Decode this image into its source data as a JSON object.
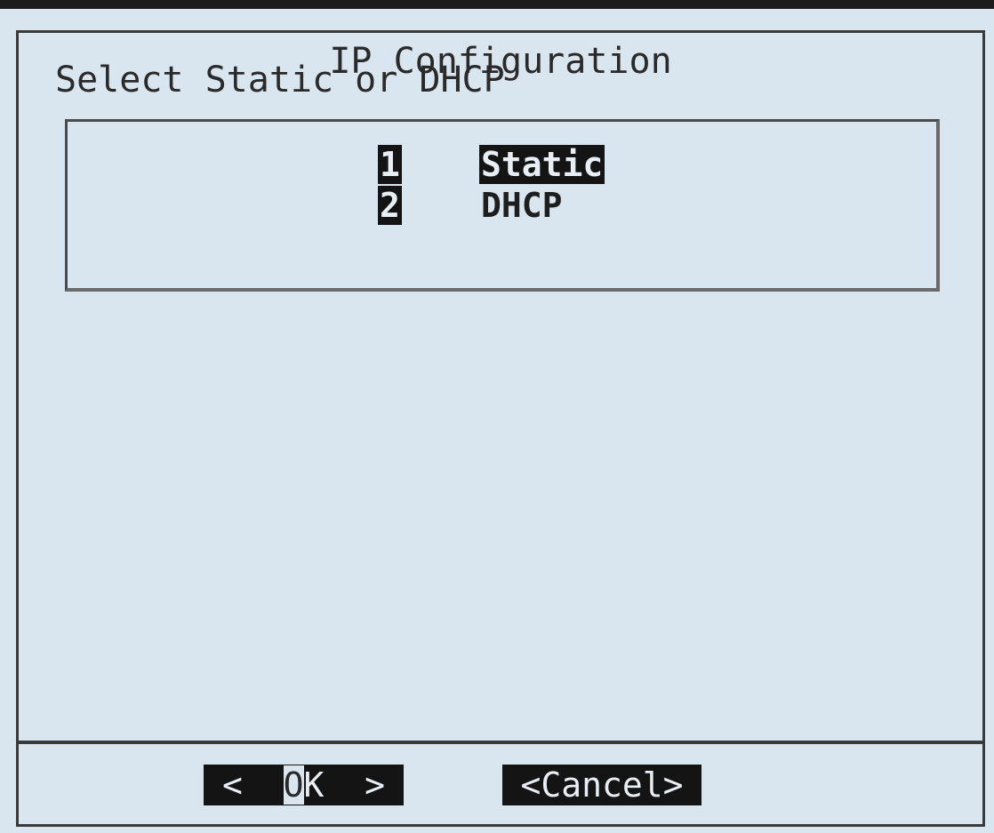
{
  "dialog": {
    "title": "IP Configuration",
    "prompt": "Select Static or DHCP"
  },
  "menu": {
    "items": [
      {
        "tag": "1",
        "label": "Static",
        "selected": true
      },
      {
        "tag": "2",
        "label": "DHCP",
        "selected": false
      }
    ]
  },
  "buttons": {
    "ok": {
      "left": "<",
      "first": "O",
      "rest": "K",
      "right": ">"
    },
    "cancel": "<Cancel>"
  },
  "colors": {
    "background": "#d9e5ef",
    "highlight": "#141414",
    "highlight_text": "#e8eef3",
    "text": "#2a2a2a",
    "screen": "#1c1c1c"
  }
}
